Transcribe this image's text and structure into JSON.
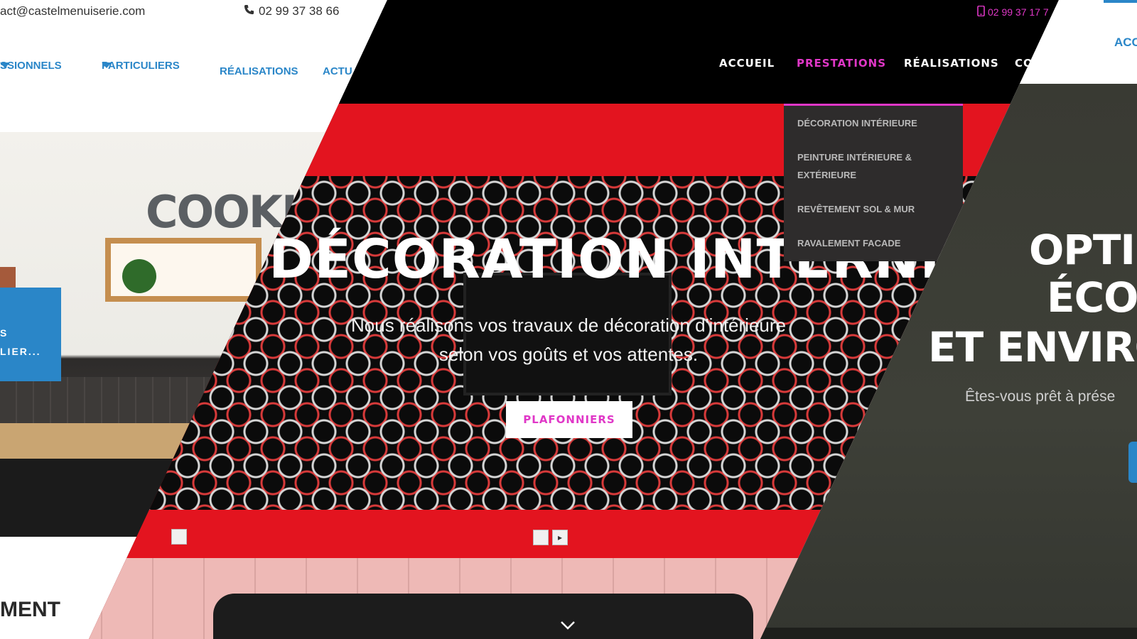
{
  "left_site": {
    "topbar": {
      "email": "act@castelmenuiserie.com",
      "phone": "02 99 37 38 66"
    },
    "nav": {
      "items": [
        "SSIONNELS",
        "PARTICULIERS",
        "RÉALISATIONS",
        "ACTU"
      ]
    },
    "hero": {
      "wall_text": "COOKIN"
    },
    "blue_card": {
      "line1": "S",
      "line2": "LIER..."
    },
    "section_title": "MENT"
  },
  "middle_site": {
    "topbar": {
      "phone": "02 99 37 17 7"
    },
    "nav": {
      "items": [
        "ACCUEIL",
        "PRESTATIONS",
        "RÉALISATIONS",
        "CO"
      ],
      "active": "PRESTATIONS"
    },
    "dropdown": {
      "items": [
        "DÉCORATION INTÉRIEURE",
        "PEINTURE INTÉRIEURE & EXTÉRIEURE",
        "REVÊTEMENT SOL & MUR",
        "RAVALEMENT FACADE"
      ]
    },
    "hero": {
      "title": "DÉCORATION INTERNE",
      "subtitle_line1": "Nous réalisons vos travaux de décoration d'intérieure",
      "subtitle_line2": "selon vos goûts et vos attentes.",
      "cta_label": "PLAFONNIERS"
    }
  },
  "right_site": {
    "nav": {
      "item": "ACC"
    },
    "hero": {
      "title_line1": "OPTI",
      "title_line2": "ÉCO",
      "title_line3": "ET ENVIRO",
      "subtitle": "Êtes-vous prêt à prése"
    }
  },
  "colors": {
    "left_accent": "#2a86c8",
    "middle_accent": "#e037c7",
    "middle_header_bg": "#000000",
    "middle_wall_red": "#e3141f",
    "right_hero_bg": "#3e4038"
  },
  "icons": {
    "left_phone": "phone-icon",
    "middle_phone": "mobile-phone-icon",
    "nav_caret": "caret-down-icon",
    "scroll_down": "chevron-down-icon",
    "slider_next": "arrow-right-icon"
  }
}
